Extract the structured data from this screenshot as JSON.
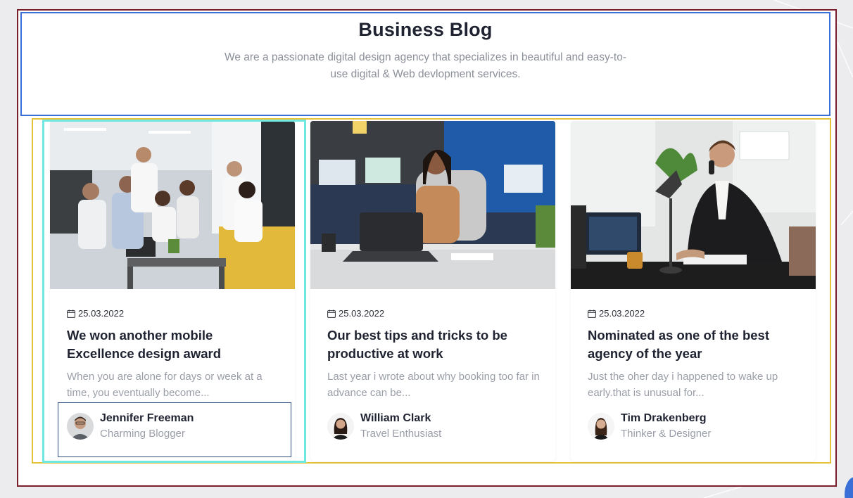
{
  "header": {
    "title": "Business Blog",
    "subtitle": "We are a passionate digital design agency that specializes in beautiful and easy-to-use digital & Web devlopment services."
  },
  "posts": [
    {
      "date": "25.03.2022",
      "title": "We won another mobile Excellence design award",
      "excerpt": "When you are alone for days or week at a time, you eventually become...",
      "author_name": "Jennifer Freeman",
      "author_role": "Charming Blogger",
      "image": "team-meeting-office-image"
    },
    {
      "date": "25.03.2022",
      "title": "Our best tips and tricks to be productive at work",
      "excerpt": "Last year i wrote about why booking too far in advance can be...",
      "author_name": "William Clark",
      "author_role": "Travel Enthusiast",
      "image": "woman-at-laptop-image"
    },
    {
      "date": "25.03.2022",
      "title": "Nominated as one of the best agency of the year",
      "excerpt": "Just the oher day i happened to wake up early.that is unusual for...",
      "author_name": "Tim Drakenberg",
      "author_role": "Thinker & Designer",
      "image": "businessman-on-phone-image"
    }
  ],
  "colors": {
    "frame_outer": "#7a1f2b",
    "header_outline": "#3a6fd8",
    "cards_outline": "#e6c23a",
    "selected_card_outline": "#6ee8e0",
    "selected_author_outline": "#2f4d80",
    "title_text": "#1f2230",
    "muted_text": "#9a9ea8"
  }
}
